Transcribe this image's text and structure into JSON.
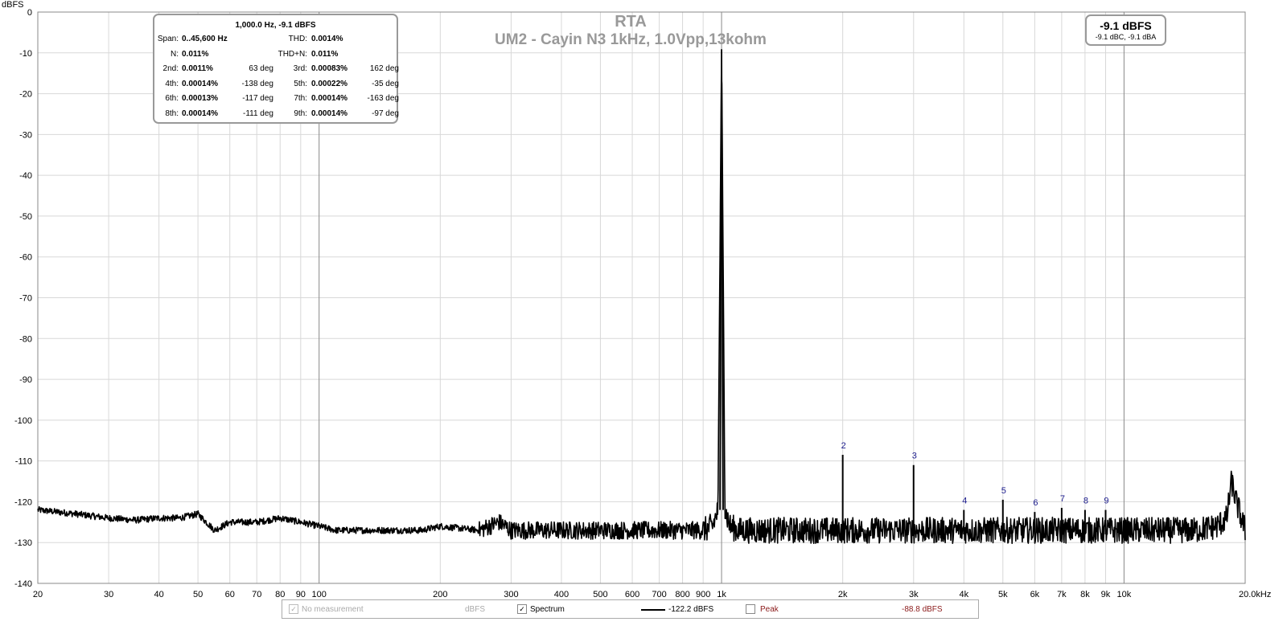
{
  "chart_data": {
    "type": "line",
    "title": "RTA",
    "subtitle": "UM2 - Cayin N3 1kHz, 1.0Vpp,13kohm",
    "ylabel": "dBFS",
    "xlabel": "",
    "xscale": "log",
    "xlim": [
      20,
      20000
    ],
    "ylim": [
      -140,
      0
    ],
    "grid": true,
    "yticks": [
      0,
      -10,
      -20,
      -30,
      -40,
      -50,
      -60,
      -70,
      -80,
      -90,
      -100,
      -110,
      -120,
      -130,
      -140
    ],
    "ytick_labels": [
      "0",
      "-10",
      "-20",
      "-30",
      "-40",
      "-50",
      "-60",
      "-70",
      "-80",
      "-90",
      "-100",
      "-110",
      "-120",
      "-130",
      "-140"
    ],
    "xticks": [
      20,
      30,
      40,
      50,
      60,
      70,
      80,
      90,
      100,
      200,
      300,
      400,
      500,
      600,
      700,
      800,
      900,
      1000,
      2000,
      3000,
      4000,
      5000,
      6000,
      7000,
      8000,
      9000,
      10000,
      20000
    ],
    "xtick_labels": [
      "20",
      "30",
      "40",
      "50",
      "60",
      "70",
      "80",
      "90",
      "100",
      "200",
      "300",
      "400",
      "500",
      "600",
      "700",
      "800",
      "900",
      "1k",
      "2k",
      "3k",
      "4k",
      "5k",
      "6k",
      "7k",
      "8k",
      "9k",
      "10k",
      "20.0kHz"
    ],
    "series": [
      {
        "name": "Spectrum",
        "color": "#000000",
        "x": [
          20,
          25,
          30,
          35,
          40,
          45,
          50,
          55,
          60,
          70,
          80,
          90,
          100,
          110,
          130,
          150,
          180,
          200,
          250,
          280,
          300,
          350,
          400,
          500,
          600,
          700,
          800,
          900,
          950,
          980,
          1000,
          1020,
          1050,
          1100,
          1300,
          1500,
          1800,
          2000,
          2500,
          3000,
          3500,
          4000,
          5000,
          6000,
          7000,
          8000,
          9000,
          10000,
          12000,
          15000,
          17000,
          18000,
          18500,
          19000,
          20000
        ],
        "y": [
          -122,
          -123,
          -124,
          -124.5,
          -124,
          -124,
          -123,
          -127,
          -125,
          -125,
          -124,
          -125,
          -126,
          -127,
          -127,
          -127,
          -127,
          -126,
          -127,
          -125,
          -127,
          -127,
          -127,
          -127,
          -127,
          -127,
          -127,
          -127,
          -126,
          -122,
          -9.1,
          -122,
          -126,
          -127,
          -127,
          -127,
          -127,
          -127,
          -127,
          -127,
          -127,
          -127,
          -127,
          -127,
          -127,
          -127,
          -127,
          -127,
          -127,
          -127,
          -126,
          -124,
          -115,
          -120,
          -127
        ]
      }
    ],
    "harmonics": [
      {
        "label": "2",
        "x": 2000,
        "y": -108.5
      },
      {
        "label": "3",
        "x": 3000,
        "y": -111
      },
      {
        "label": "4",
        "x": 4000,
        "y": -122
      },
      {
        "label": "5",
        "x": 5000,
        "y": -119.5
      },
      {
        "label": "6",
        "x": 6000,
        "y": -122.5
      },
      {
        "label": "7",
        "x": 7000,
        "y": -121.5
      },
      {
        "label": "8",
        "x": 8000,
        "y": -122
      },
      {
        "label": "9",
        "x": 9000,
        "y": -122
      }
    ]
  },
  "stats": {
    "header": "1,000.0 Hz, -9.1 dBFS",
    "rows": [
      [
        {
          "l": "Span:",
          "v": "0..45,600 Hz"
        },
        {
          "l": "THD:",
          "v": "0.0014%"
        }
      ],
      [
        {
          "l": "N:",
          "v": "0.011%"
        },
        {
          "l": "THD+N:",
          "v": "0.011%"
        }
      ],
      [
        {
          "l": "2nd:",
          "v": "0.0011%",
          "d": "63 deg"
        },
        {
          "l": "3rd:",
          "v": "0.00083%",
          "d": "162 deg"
        }
      ],
      [
        {
          "l": "4th:",
          "v": "0.00014%",
          "d": "-138 deg"
        },
        {
          "l": "5th:",
          "v": "0.00022%",
          "d": "-35 deg"
        }
      ],
      [
        {
          "l": "6th:",
          "v": "0.00013%",
          "d": "-117 deg"
        },
        {
          "l": "7th:",
          "v": "0.00014%",
          "d": "-163 deg"
        }
      ],
      [
        {
          "l": "8th:",
          "v": "0.00014%",
          "d": "-111 deg"
        },
        {
          "l": "9th:",
          "v": "0.00014%",
          "d": "-97 deg"
        }
      ]
    ]
  },
  "level": {
    "main": "-9.1 dBFS",
    "sub": "-9.1 dBC, -9.1 dBA"
  },
  "legend": {
    "no_measurement": "No measurement",
    "no_measurement_unit": "dBFS",
    "spectrum": "Spectrum",
    "spectrum_value": "-122.2 dBFS",
    "peak": "Peak",
    "peak_value": "-88.8 dBFS",
    "peak_color": "#8b1a1a"
  }
}
